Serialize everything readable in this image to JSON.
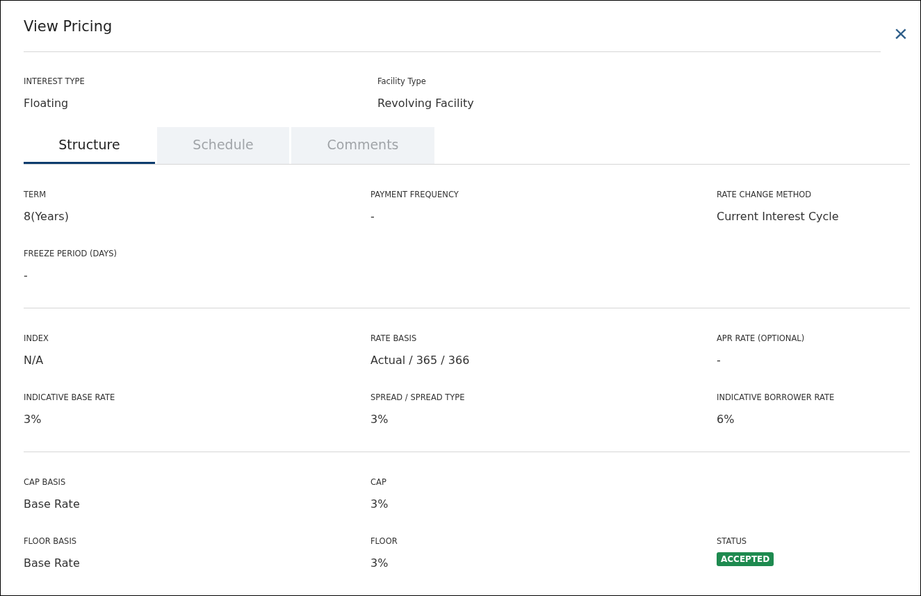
{
  "dialog": {
    "title": "View Pricing",
    "close": "×"
  },
  "summary": [
    {
      "label": "INTEREST TYPE",
      "value": "Floating"
    },
    {
      "label": "Facility Type",
      "value": "Revolving Facility"
    }
  ],
  "tabs": [
    {
      "label": "Structure",
      "selected": true
    },
    {
      "label": "Schedule",
      "selected": false
    },
    {
      "label": "Comments",
      "selected": false
    }
  ],
  "sections": [
    {
      "rows": [
        [
          {
            "kind": "text",
            "label": "TERM",
            "value": "8(Years)"
          },
          {
            "kind": "text",
            "label": "PAYMENT FREQUENCY",
            "value": "-"
          },
          {
            "kind": "text",
            "label": "RATE CHANGE METHOD",
            "value": "Current Interest Cycle"
          }
        ],
        [
          {
            "kind": "text",
            "label": "FREEZE PERIOD (DAYS)",
            "value": "-"
          }
        ]
      ]
    },
    {
      "rows": [
        [
          {
            "kind": "text",
            "label": "INDEX",
            "value": "N/A"
          },
          {
            "kind": "text",
            "label": "RATE BASIS",
            "value": "Actual / 365 / 366"
          },
          {
            "kind": "text",
            "label": "APR RATE (OPTIONAL)",
            "value": "-"
          }
        ],
        [
          {
            "kind": "text",
            "label": "INDICATIVE BASE RATE",
            "value": "3%"
          },
          {
            "kind": "text",
            "label": "SPREAD / SPREAD TYPE",
            "value": "3%"
          },
          {
            "kind": "text",
            "label": "INDICATIVE BORROWER RATE",
            "value": "6%"
          }
        ]
      ]
    },
    {
      "rows": [
        [
          {
            "kind": "text",
            "label": "CAP BASIS",
            "value": "Base Rate"
          },
          {
            "kind": "text",
            "label": "CAP",
            "value": "3%"
          }
        ],
        [
          {
            "kind": "text",
            "label": "FLOOR BASIS",
            "value": "Base Rate"
          },
          {
            "kind": "text",
            "label": "FLOOR",
            "value": "3%"
          },
          {
            "kind": "badge",
            "label": "STATUS",
            "value": "ACCEPTED",
            "color": "#1e8a4f"
          }
        ]
      ]
    }
  ]
}
